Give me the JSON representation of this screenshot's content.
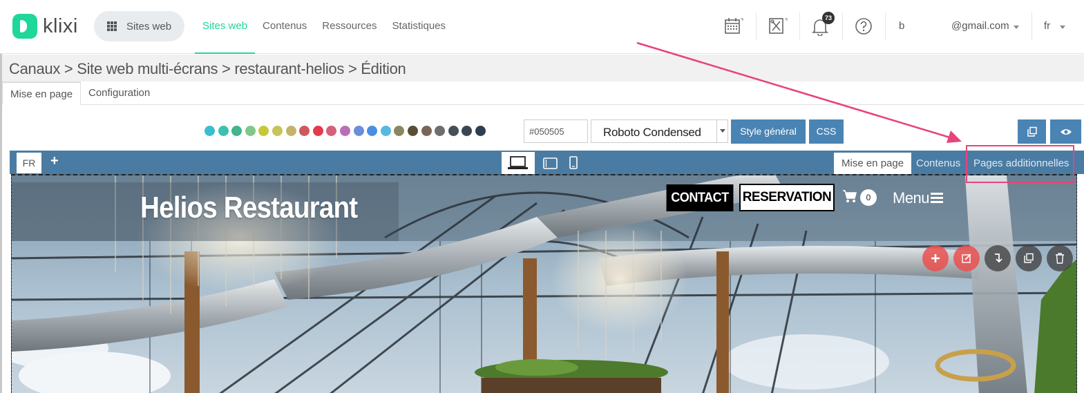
{
  "brand": {
    "name": "klixi",
    "accent": "#1ed79a"
  },
  "topnav": {
    "sites_button": "Sites web",
    "links": [
      {
        "label": "Sites web",
        "active": true
      },
      {
        "label": "Contenus",
        "active": false
      },
      {
        "label": "Ressources",
        "active": false
      },
      {
        "label": "Statistiques",
        "active": false
      }
    ],
    "icons": [
      "calendar-icon",
      "tools-icon",
      "bell-icon",
      "help-icon"
    ],
    "notification_count": "73",
    "user_name": "b",
    "user_email": "@gmail.com",
    "language": "fr"
  },
  "breadcrumb": "Canaux > Site web multi-écrans > restaurant-helios > Édition",
  "page_tabs": [
    {
      "label": "Mise en page",
      "active": true
    },
    {
      "label": "Configuration",
      "active": false
    }
  ],
  "style_toolbar": {
    "palette": [
      "#3bbfcf",
      "#3ec0b0",
      "#43b48b",
      "#7fc78a",
      "#c7c837",
      "#c6c45a",
      "#c4b46a",
      "#cc5a5d",
      "#e23c4c",
      "#d4607a",
      "#b96fb6",
      "#6c8ed8",
      "#4b8fe2",
      "#57b9de",
      "#8a8760",
      "#5a4e38",
      "#7a6558",
      "#6e6e6e",
      "#475059",
      "#3a4652",
      "#2d3e50"
    ],
    "hex_value": "#050505",
    "font_value": "Roboto Condensed",
    "general_style_button": "Style général",
    "css_button": "CSS"
  },
  "editor_bar": {
    "language_button": "FR",
    "add_symbol": "+",
    "tabs": [
      {
        "label": "Mise en page",
        "active": true
      },
      {
        "label": "Contenus",
        "active": false
      },
      {
        "label": "Pages additionnelles",
        "active": false
      }
    ]
  },
  "preview": {
    "site_title": "Helios Restaurant",
    "contact_button": "CONTACT",
    "reservation_button": "RESERVATION",
    "cart_count": "0",
    "menu_label": "Menu"
  }
}
